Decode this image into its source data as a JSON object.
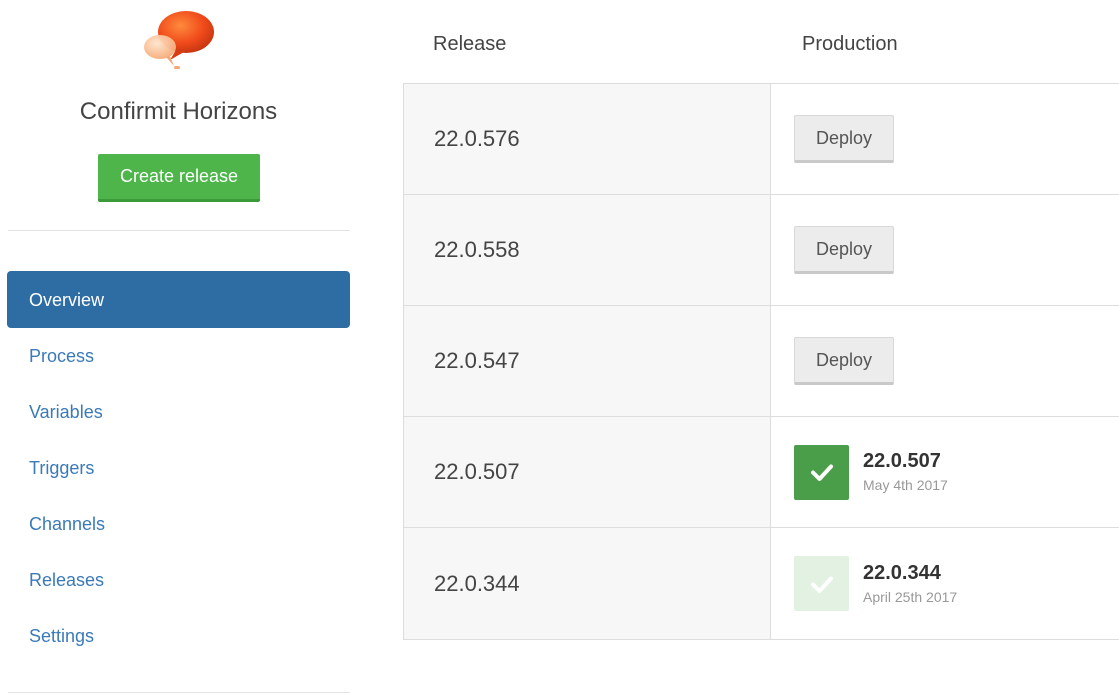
{
  "sidebar": {
    "logo_icon": "speech-bubbles-logo",
    "project_name": "Confirmit Horizons",
    "create_release_label": "Create release",
    "nav": [
      {
        "label": "Overview",
        "active": true
      },
      {
        "label": "Process",
        "active": false
      },
      {
        "label": "Variables",
        "active": false
      },
      {
        "label": "Triggers",
        "active": false
      },
      {
        "label": "Channels",
        "active": false
      },
      {
        "label": "Releases",
        "active": false
      },
      {
        "label": "Settings",
        "active": false
      }
    ]
  },
  "table": {
    "headers": {
      "release": "Release",
      "production": "Production"
    },
    "rows": [
      {
        "release": "22.0.576",
        "deploy_label": "Deploy"
      },
      {
        "release": "22.0.558",
        "deploy_label": "Deploy"
      },
      {
        "release": "22.0.547",
        "deploy_label": "Deploy"
      },
      {
        "release": "22.0.507",
        "deployed_version": "22.0.507",
        "deployed_date": "May 4th 2017",
        "status": "current"
      },
      {
        "release": "22.0.344",
        "deployed_version": "22.0.344",
        "deployed_date": "April 25th 2017",
        "status": "previous"
      }
    ]
  },
  "colors": {
    "accent_blue": "#2e6da4",
    "link_blue": "#3a7ab8",
    "success_green": "#4db54a",
    "deployed_green": "#4b9e49",
    "previous_green": "#e2f1e2"
  }
}
